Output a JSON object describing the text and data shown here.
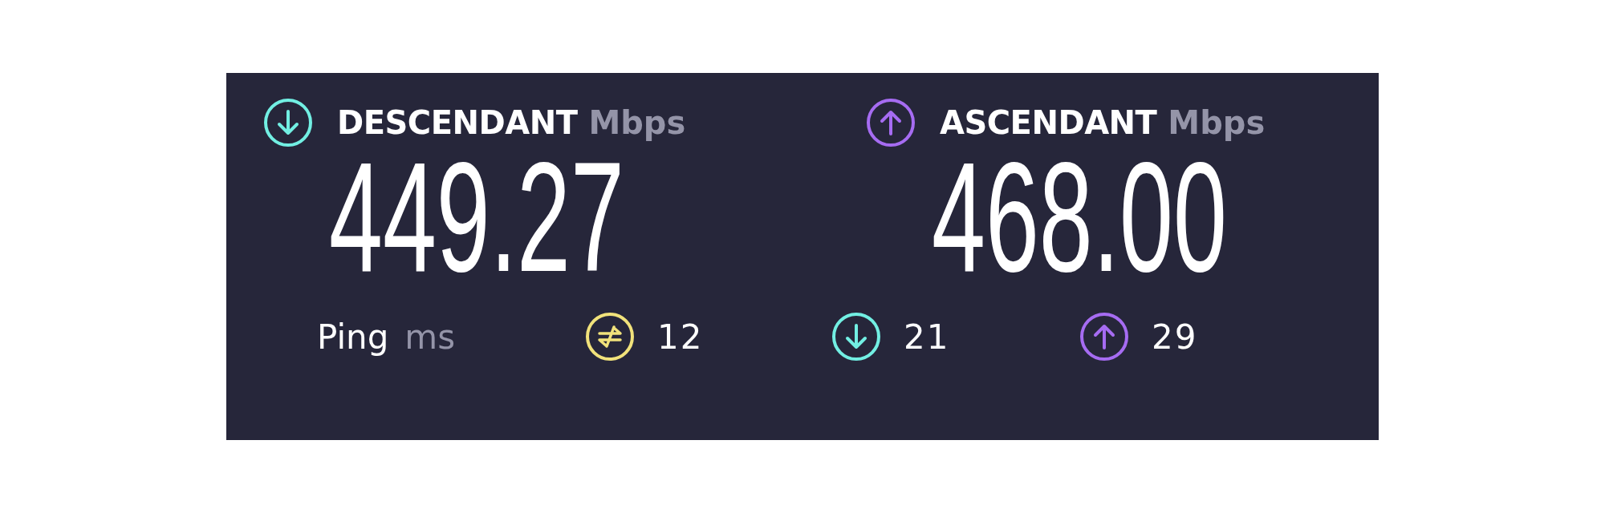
{
  "speeds": [
    {
      "kind": "download",
      "label": "DESCENDANT",
      "unit": "Mbps",
      "value": "449.27"
    },
    {
      "kind": "upload",
      "label": "ASCENDANT",
      "unit": "Mbps",
      "value": "468.00"
    }
  ],
  "ping": {
    "label": "Ping",
    "unit": "ms",
    "stats": [
      {
        "kind": "idle",
        "value": "12"
      },
      {
        "kind": "download",
        "value": "21"
      },
      {
        "kind": "upload",
        "value": "29"
      }
    ]
  }
}
